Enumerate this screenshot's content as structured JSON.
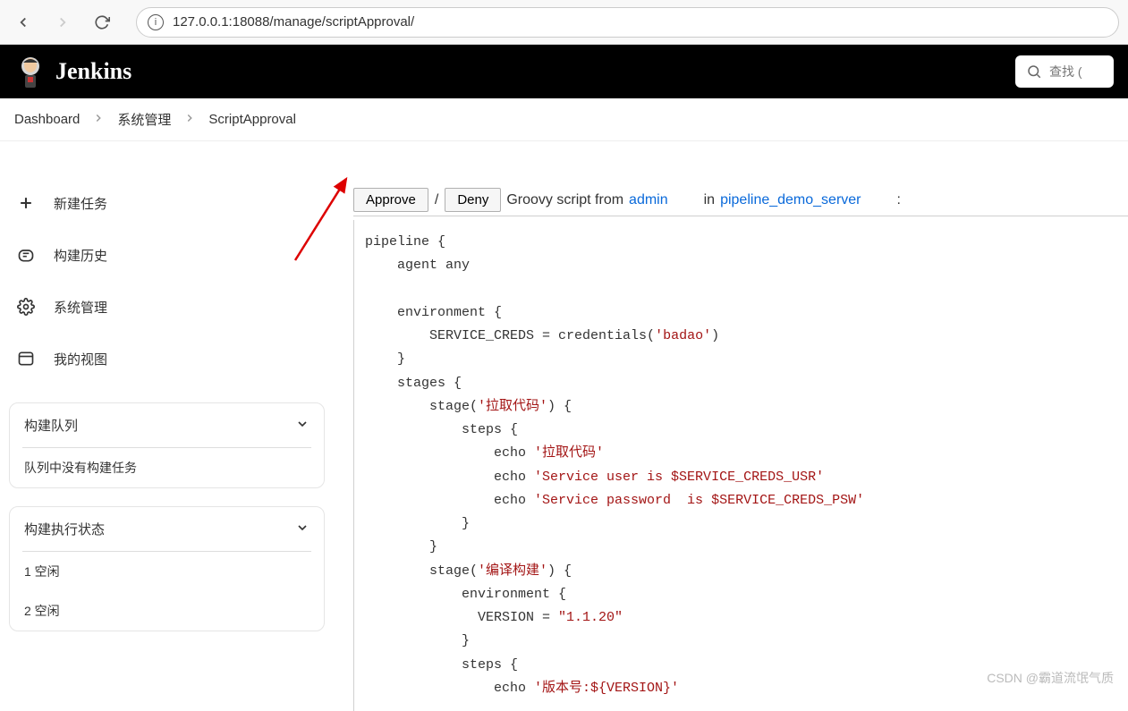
{
  "browser": {
    "url": "127.0.0.1:18088/manage/scriptApproval/"
  },
  "header": {
    "title": "Jenkins",
    "search_placeholder": "查找 ("
  },
  "breadcrumb": {
    "items": [
      "Dashboard",
      "系统管理",
      "ScriptApproval"
    ]
  },
  "sidebar": {
    "items": [
      {
        "icon": "plus-icon",
        "label": "新建任务"
      },
      {
        "icon": "history-icon",
        "label": "构建历史"
      },
      {
        "icon": "gear-icon",
        "label": "系统管理"
      },
      {
        "icon": "window-icon",
        "label": "我的视图"
      }
    ],
    "queue": {
      "title": "构建队列",
      "empty_text": "队列中没有构建任务"
    },
    "executors": {
      "title": "构建执行状态",
      "rows": [
        "1  空闲",
        "2  空闲"
      ]
    }
  },
  "approval": {
    "approve_label": "Approve",
    "deny_label": "Deny",
    "script_text": "Groovy script from ",
    "user": "admin",
    "in_text": "in ",
    "job": "pipeline_demo_server",
    "code_tokens": [
      {
        "t": "plain",
        "v": "pipeline {\n    agent any\n\n    environment {\n        SERVICE_CREDS = credentials("
      },
      {
        "t": "str",
        "v": "'badao'"
      },
      {
        "t": "plain",
        "v": ")\n    }\n    stages {\n        stage("
      },
      {
        "t": "str",
        "v": "'拉取代码'"
      },
      {
        "t": "plain",
        "v": ") {\n            steps {\n                echo "
      },
      {
        "t": "str",
        "v": "'拉取代码'"
      },
      {
        "t": "plain",
        "v": "\n                echo "
      },
      {
        "t": "str",
        "v": "'Service user is $SERVICE_CREDS_USR'"
      },
      {
        "t": "plain",
        "v": "\n                echo "
      },
      {
        "t": "str",
        "v": "'Service password  is $SERVICE_CREDS_PSW'"
      },
      {
        "t": "plain",
        "v": "\n            }\n        }\n        stage("
      },
      {
        "t": "str",
        "v": "'编译构建'"
      },
      {
        "t": "plain",
        "v": ") {\n            environment {\n              VERSION = "
      },
      {
        "t": "str",
        "v": "\"1.1.20\""
      },
      {
        "t": "plain",
        "v": "\n            }\n            steps {\n                echo "
      },
      {
        "t": "str",
        "v": "'版本号:${VERSION}'"
      },
      {
        "t": "plain",
        "v": ""
      }
    ]
  },
  "watermark": "CSDN @霸道流氓气质"
}
